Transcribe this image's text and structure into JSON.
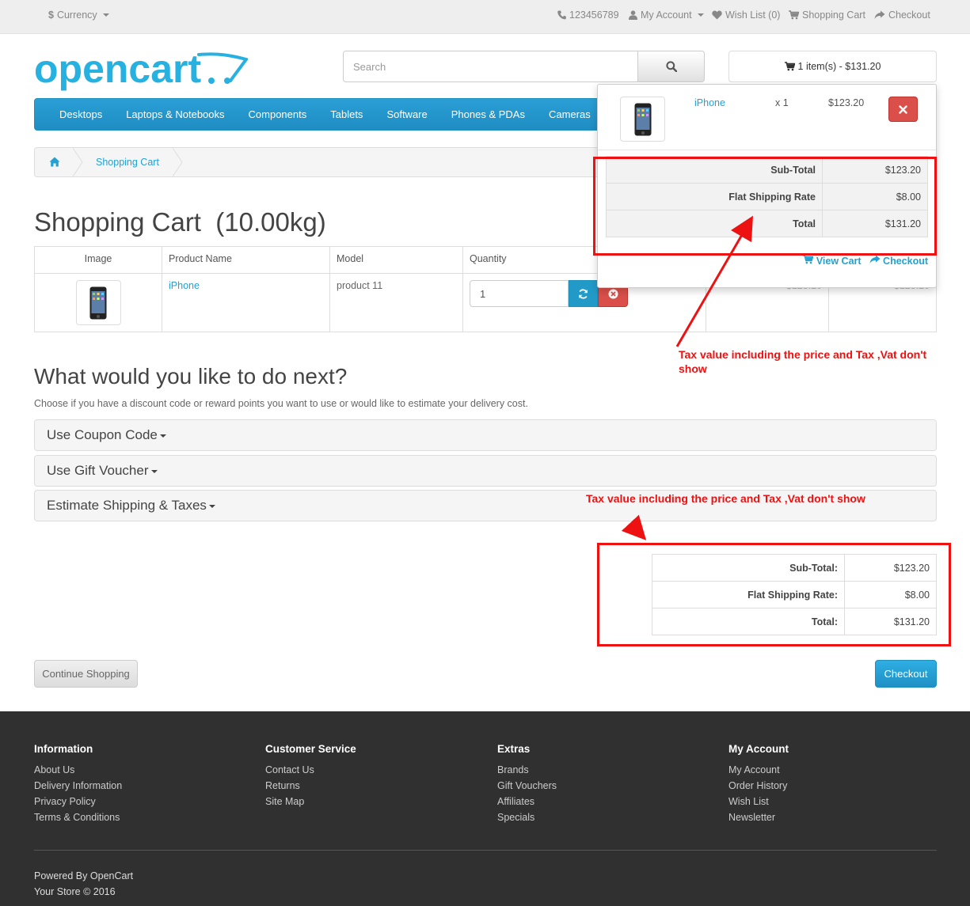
{
  "topbar": {
    "currency": "Currency",
    "phone": "123456789",
    "my_account": "My Account",
    "wish_list": "Wish List (0)",
    "shopping_cart": "Shopping Cart",
    "checkout": "Checkout"
  },
  "header": {
    "logo_text": "opencart",
    "search_placeholder": "Search",
    "cart_button": "1 item(s) - $131.20"
  },
  "menu": [
    "Desktops",
    "Laptops & Notebooks",
    "Components",
    "Tablets",
    "Software",
    "Phones & PDAs",
    "Cameras"
  ],
  "breadcrumb": {
    "current": "Shopping Cart"
  },
  "page_title": "Shopping Cart  (10.00kg)",
  "cart_table": {
    "headers": {
      "image": "Image",
      "product_name": "Product Name",
      "model": "Model",
      "quantity": "Quantity"
    },
    "row": {
      "product_name": "iPhone",
      "model": "product 11",
      "quantity": "1",
      "unit_price": "$123.20",
      "total": "$123.20"
    }
  },
  "next": {
    "heading": "What would you like to do next?",
    "description": "Choose if you have a discount code or reward points you want to use or would like to estimate your delivery cost.",
    "panels": [
      "Use Coupon Code",
      "Use Gift Voucher",
      "Estimate Shipping & Taxes"
    ]
  },
  "totals": [
    {
      "label": "Sub-Total:",
      "value": "$123.20"
    },
    {
      "label": "Flat Shipping Rate:",
      "value": "$8.00"
    },
    {
      "label": "Total:",
      "value": "$131.20"
    }
  ],
  "buttons": {
    "continue": "Continue Shopping",
    "checkout": "Checkout"
  },
  "dropdown": {
    "product": "iPhone",
    "qty": "x 1",
    "price": "$123.20",
    "totals": [
      {
        "label": "Sub-Total",
        "value": "$123.20"
      },
      {
        "label": "Flat Shipping Rate",
        "value": "$8.00"
      },
      {
        "label": "Total",
        "value": "$131.20"
      }
    ],
    "view_cart": "View Cart",
    "checkout": "Checkout"
  },
  "annotations": {
    "note_1": "Tax value including the price and Tax ,Vat don't show",
    "note_2": "Tax value including the price and Tax ,Vat don't show",
    "color": "#ee1111"
  },
  "footer": {
    "columns": [
      {
        "title": "Information",
        "links": [
          "About Us",
          "Delivery Information",
          "Privacy Policy",
          "Terms & Conditions"
        ]
      },
      {
        "title": "Customer Service",
        "links": [
          "Contact Us",
          "Returns",
          "Site Map"
        ]
      },
      {
        "title": "Extras",
        "links": [
          "Brands",
          "Gift Vouchers",
          "Affiliates",
          "Specials"
        ]
      },
      {
        "title": "My Account",
        "links": [
          "My Account",
          "Order History",
          "Wish List",
          "Newsletter"
        ]
      }
    ],
    "powered_by": "Powered By",
    "powered_link": "OpenCart",
    "copyright": "Your Store © 2016"
  },
  "colors": {
    "accent": "#23a1d1",
    "danger": "#da4f49",
    "footer_bg": "#303030"
  }
}
